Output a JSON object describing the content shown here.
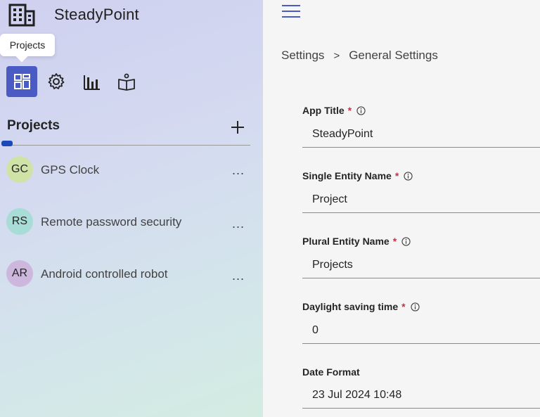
{
  "app": {
    "name": "SteadyPoint",
    "logo_icon": "building-icon"
  },
  "tooltip": {
    "text": "Projects"
  },
  "nav": [
    {
      "name": "projects",
      "icon": "grid-icon",
      "active": true
    },
    {
      "name": "settings",
      "icon": "gear-icon",
      "active": false
    },
    {
      "name": "reports",
      "icon": "bar-chart-icon",
      "active": false
    },
    {
      "name": "docs",
      "icon": "book-icon",
      "active": false
    }
  ],
  "projects": {
    "title": "Projects",
    "add_icon": "plus-icon",
    "items": [
      {
        "initials": "GC",
        "label": "GPS Clock",
        "color": "#cfe3a6",
        "more": "..."
      },
      {
        "initials": "RS",
        "label": "Remote password security",
        "color": "#a8dcd6",
        "more": "..."
      },
      {
        "initials": "AR",
        "label": "Android controlled robot",
        "color": "#cdb7dd",
        "more": "..."
      }
    ]
  },
  "main": {
    "breadcrumb": {
      "root": "Settings",
      "separator": ">",
      "current": "General Settings"
    },
    "fields": [
      {
        "label": "App Title",
        "required": true,
        "info": true,
        "value": "SteadyPoint"
      },
      {
        "label": "Single Entity Name",
        "required": true,
        "info": true,
        "value": "Project"
      },
      {
        "label": "Plural Entity Name",
        "required": true,
        "info": true,
        "value": "Projects"
      },
      {
        "label": "Daylight saving time",
        "required": true,
        "info": true,
        "value": "0"
      },
      {
        "label": "Date Format",
        "required": false,
        "info": false,
        "value": "23 Jul 2024 10:48"
      }
    ]
  },
  "colors": {
    "accent": "#4a5bc4",
    "required": "#c4314b"
  }
}
